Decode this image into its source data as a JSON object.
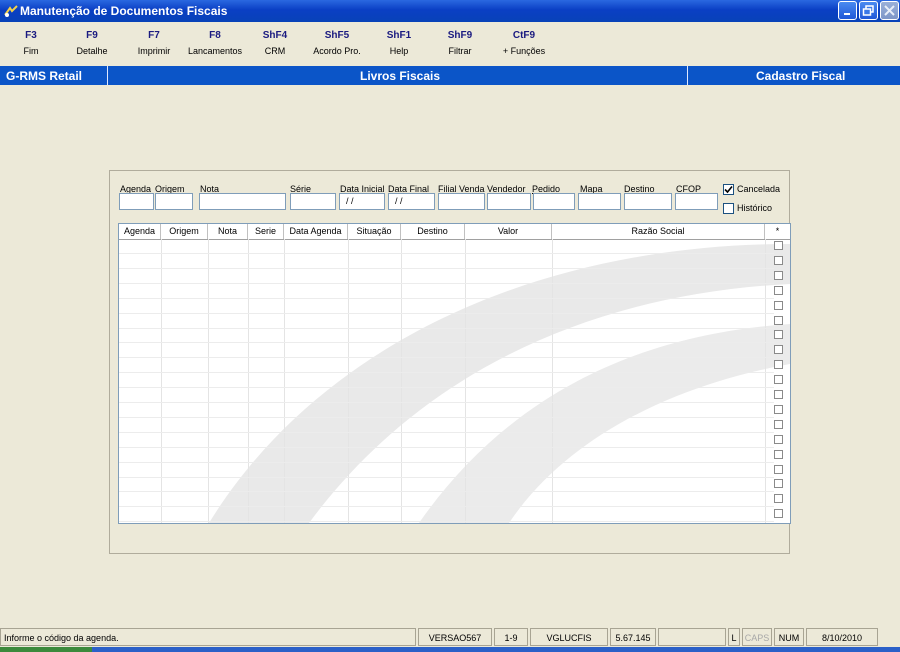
{
  "window": {
    "title": "Manutenção de Documentos Fiscais"
  },
  "toolbar": {
    "buttons": [
      {
        "key": "F3",
        "label": "Fim"
      },
      {
        "key": "F9",
        "label": "Detalhe"
      },
      {
        "key": "F7",
        "label": "Imprimir"
      },
      {
        "key": "F8",
        "label": "Lancamentos"
      },
      {
        "key": "ShF4",
        "label": "CRM"
      },
      {
        "key": "ShF5",
        "label": "Acordo Pro."
      },
      {
        "key": "ShF1",
        "label": "Help"
      },
      {
        "key": "ShF9",
        "label": "Filtrar"
      },
      {
        "key": "CtF9",
        "label": "+ Funções"
      }
    ]
  },
  "header": {
    "left": "G-RMS Retail",
    "center": "Livros Fiscais",
    "right": "Cadastro Fiscal"
  },
  "filters": {
    "agenda": {
      "label": "Agenda",
      "value": ""
    },
    "origem": {
      "label": "Origem",
      "value": ""
    },
    "nota": {
      "label": "Nota",
      "value": ""
    },
    "serie": {
      "label": "Série",
      "value": ""
    },
    "data_inicial": {
      "label": "Data Inicial",
      "value": "/ /"
    },
    "data_final": {
      "label": "Data Final",
      "value": "/ /"
    },
    "filial_venda": {
      "label": "Filial Venda",
      "value": ""
    },
    "vendedor": {
      "label": "Vendedor",
      "value": ""
    },
    "pedido": {
      "label": "Pedido",
      "value": ""
    },
    "mapa": {
      "label": "Mapa",
      "value": ""
    },
    "destino": {
      "label": "Destino",
      "value": ""
    },
    "cfop": {
      "label": "CFOP",
      "value": ""
    },
    "cancelada": {
      "label": "Cancelada",
      "checked": true
    },
    "historico": {
      "label": "Histórico",
      "checked": false
    }
  },
  "grid": {
    "columns": [
      "Agenda",
      "Origem",
      "Nota",
      "Serie",
      "Data Agenda",
      "Situação",
      "Destino",
      "Valor",
      "Razão Social",
      "*"
    ],
    "rows": 20
  },
  "status": {
    "message": "Informe o código da agenda.",
    "version": "VERSAO567",
    "page": "1-9",
    "module": "VGLUCFIS",
    "build": "5.67.145",
    "l": "L",
    "caps": "CAPS",
    "num": "NUM",
    "date": "8/10/2010"
  },
  "colors": {
    "title_bar": "#0a3fc4",
    "header_bar": "#0b55c8",
    "background": "#ece9d8"
  }
}
